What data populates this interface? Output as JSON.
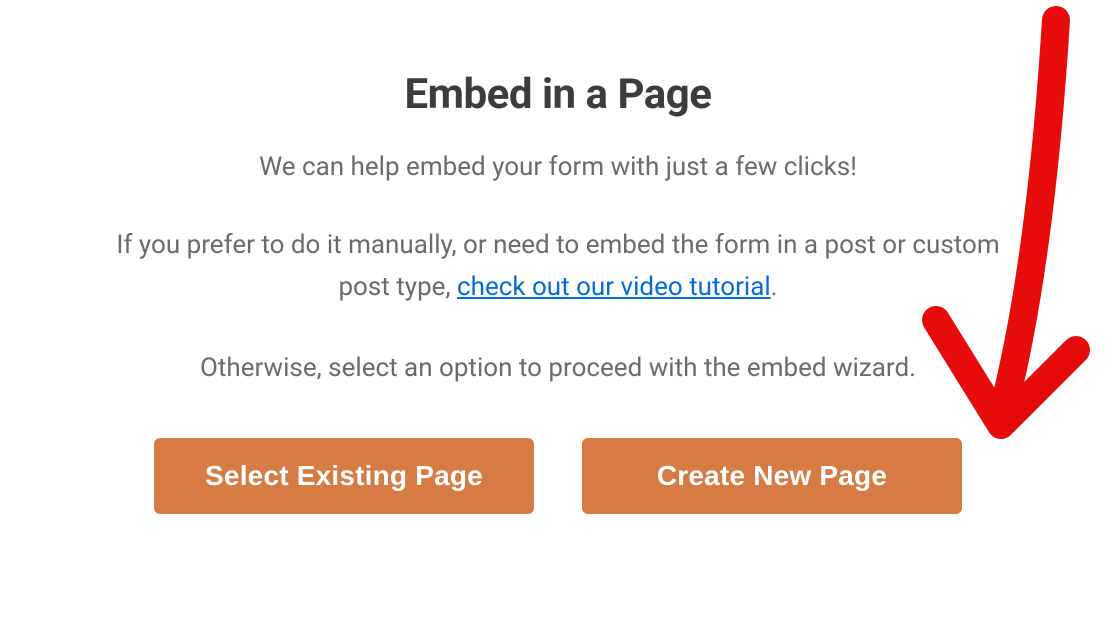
{
  "modal": {
    "title": "Embed in a Page",
    "subtitle": "We can help embed your form with just a few clicks!",
    "paragraph_prefix": "If you prefer to do it manually, or need to embed the form in a post or custom post type, ",
    "link_text": "check out our video tutorial",
    "paragraph_suffix": ".",
    "footer": "Otherwise, select an option to proceed with the embed wizard.",
    "buttons": {
      "select_existing": "Select Existing Page",
      "create_new": "Create New Page"
    }
  },
  "annotation": {
    "arrow_color": "#e60c0c"
  }
}
